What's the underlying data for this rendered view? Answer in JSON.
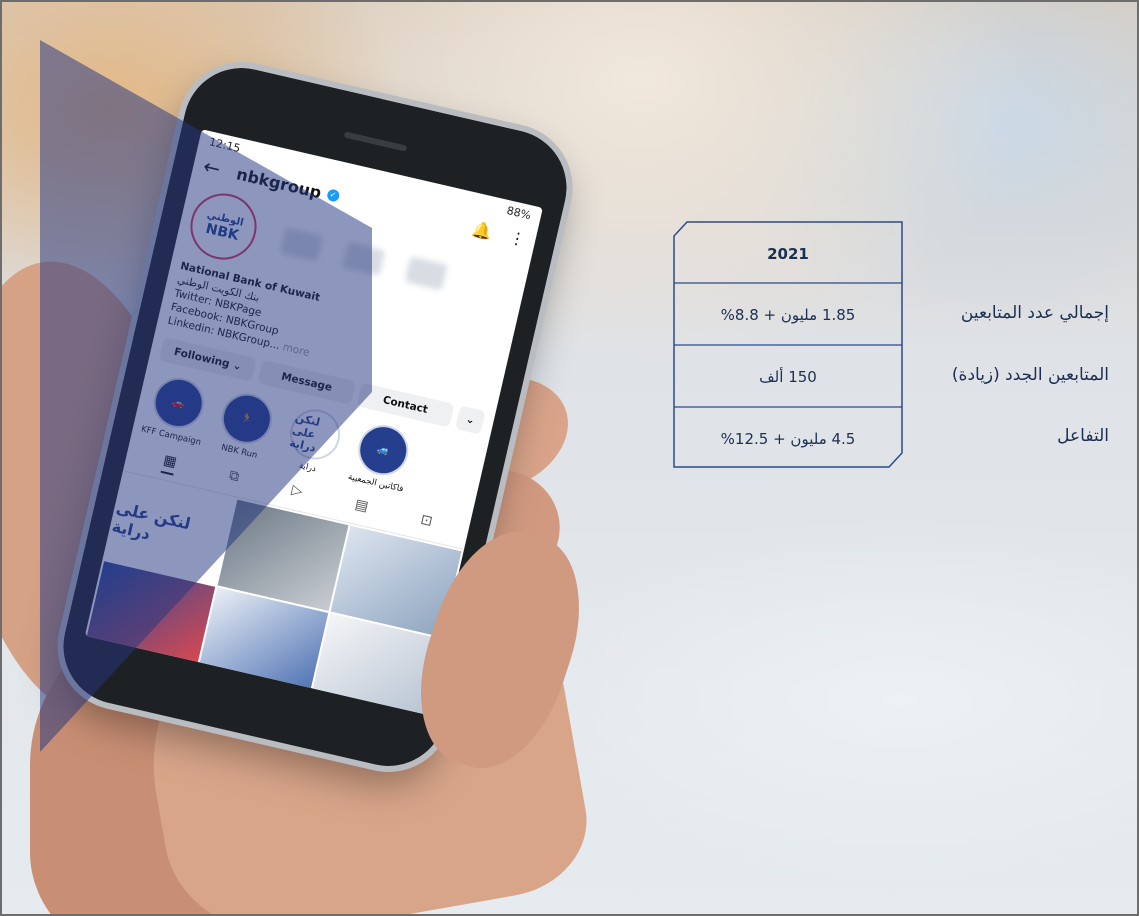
{
  "phone": {
    "status": {
      "time": "12:15",
      "battery": "88%"
    },
    "profile": {
      "handle": "nbkgroup",
      "logo_arabic": "الوطني",
      "logo_english": "NBK",
      "bio_lines": [
        "National Bank of Kuwait",
        "بنك الكويت الوطني",
        "Twitter: NBKPage",
        "Facebook: NBKGroup",
        "Linkedin: NBKGroup..."
      ],
      "bio_more": "more",
      "buttons": {
        "following": "Following ⌄",
        "message": "Message",
        "contact": "Contact"
      }
    },
    "highlights": [
      {
        "label": "KFF Campaign",
        "icon": "car-icon"
      },
      {
        "label": "NBK Run",
        "icon": "runner-icon"
      },
      {
        "label": "دراية",
        "circle_text": "لنكن على دراية"
      },
      {
        "label": "فاكاتين الجمعيية",
        "icon": "car-icon"
      }
    ],
    "grid_cell_text": "لنكن على دراية"
  },
  "table": {
    "header": "2021",
    "rows": [
      {
        "label": "إجمالي عدد المتابعين",
        "value": "1.85 مليون + 8.8%"
      },
      {
        "label": "المتابعين الجدد (زيادة)",
        "value": "150 ألف"
      },
      {
        "label": "التفاعل",
        "value": "4.5 مليون + 12.5%"
      }
    ]
  },
  "colors": {
    "accent": "#2a4b8c",
    "overlay": "#24367e",
    "text": "#1c2f52"
  }
}
